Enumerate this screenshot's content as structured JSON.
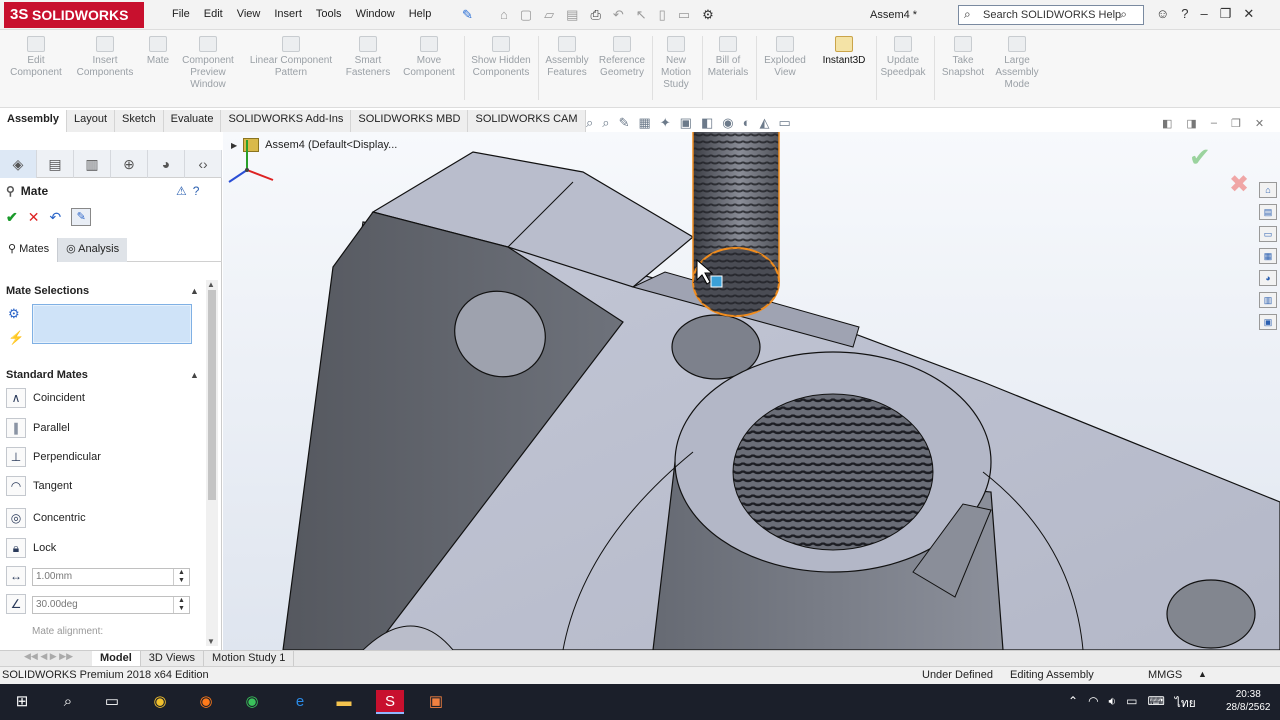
{
  "app": {
    "logo_prefix": "3S",
    "logo_text": "SOLIDWORKS",
    "doc_title": "Assem4 *"
  },
  "menu": [
    "File",
    "Edit",
    "View",
    "Insert",
    "Tools",
    "Window",
    "Help"
  ],
  "search": {
    "placeholder": "Search SOLIDWORKS Help"
  },
  "commands": [
    {
      "label": "Edit Component",
      "enabled": false
    },
    {
      "label": "Insert Components",
      "enabled": false
    },
    {
      "label": "Mate",
      "enabled": false
    },
    {
      "label": "Component Preview Window",
      "enabled": false
    },
    {
      "label": "Linear Component Pattern",
      "enabled": false
    },
    {
      "label": "Smart Fasteners",
      "enabled": false
    },
    {
      "label": "Move Component",
      "enabled": false
    },
    {
      "label": "Show Hidden Components",
      "enabled": false
    },
    {
      "label": "Assembly Features",
      "enabled": false
    },
    {
      "label": "Reference Geometry",
      "enabled": false
    },
    {
      "label": "New Motion Study",
      "enabled": false
    },
    {
      "label": "Bill of Materials",
      "enabled": false
    },
    {
      "label": "Exploded View",
      "enabled": false
    },
    {
      "label": "Instant3D",
      "enabled": true
    },
    {
      "label": "Update Speedpak",
      "enabled": false
    },
    {
      "label": "Take Snapshot",
      "enabled": false
    },
    {
      "label": "Large Assembly Mode",
      "enabled": false
    }
  ],
  "tabs": [
    "Assembly",
    "Layout",
    "Sketch",
    "Evaluate",
    "SOLIDWORKS Add-Ins",
    "SOLIDWORKS MBD",
    "SOLIDWORKS CAM"
  ],
  "active_tab": "Assembly",
  "tree": {
    "root_label": "Assem4  (Default<Display..."
  },
  "property_manager": {
    "title": "Mate",
    "subtabs": [
      "Mates",
      "Analysis"
    ],
    "sections": {
      "mate_selections": "Mate Selections",
      "standard_mates": "Standard Mates"
    },
    "standard_mates": [
      "Coincident",
      "Parallel",
      "Perpendicular",
      "Tangent",
      "Concentric",
      "Lock"
    ],
    "distance_value": "1.00mm",
    "angle_value": "30.00deg",
    "mate_alignment": "Mate alignment:"
  },
  "model_tabs": [
    "Model",
    "3D Views",
    "Motion Study 1"
  ],
  "status": {
    "edition": "SOLIDWORKS Premium 2018 x64 Edition",
    "state": "Under Defined",
    "mode": "Editing Assembly",
    "units": "MMGS"
  },
  "taskbar": {
    "time": "20:38",
    "date": "28/8/2562",
    "lang": "ไทย"
  },
  "colors": {
    "brand": "#c8102e",
    "accent": "#2a64c8",
    "selection": "#cfe3f8",
    "highlight_edge": "#f08c1e"
  }
}
